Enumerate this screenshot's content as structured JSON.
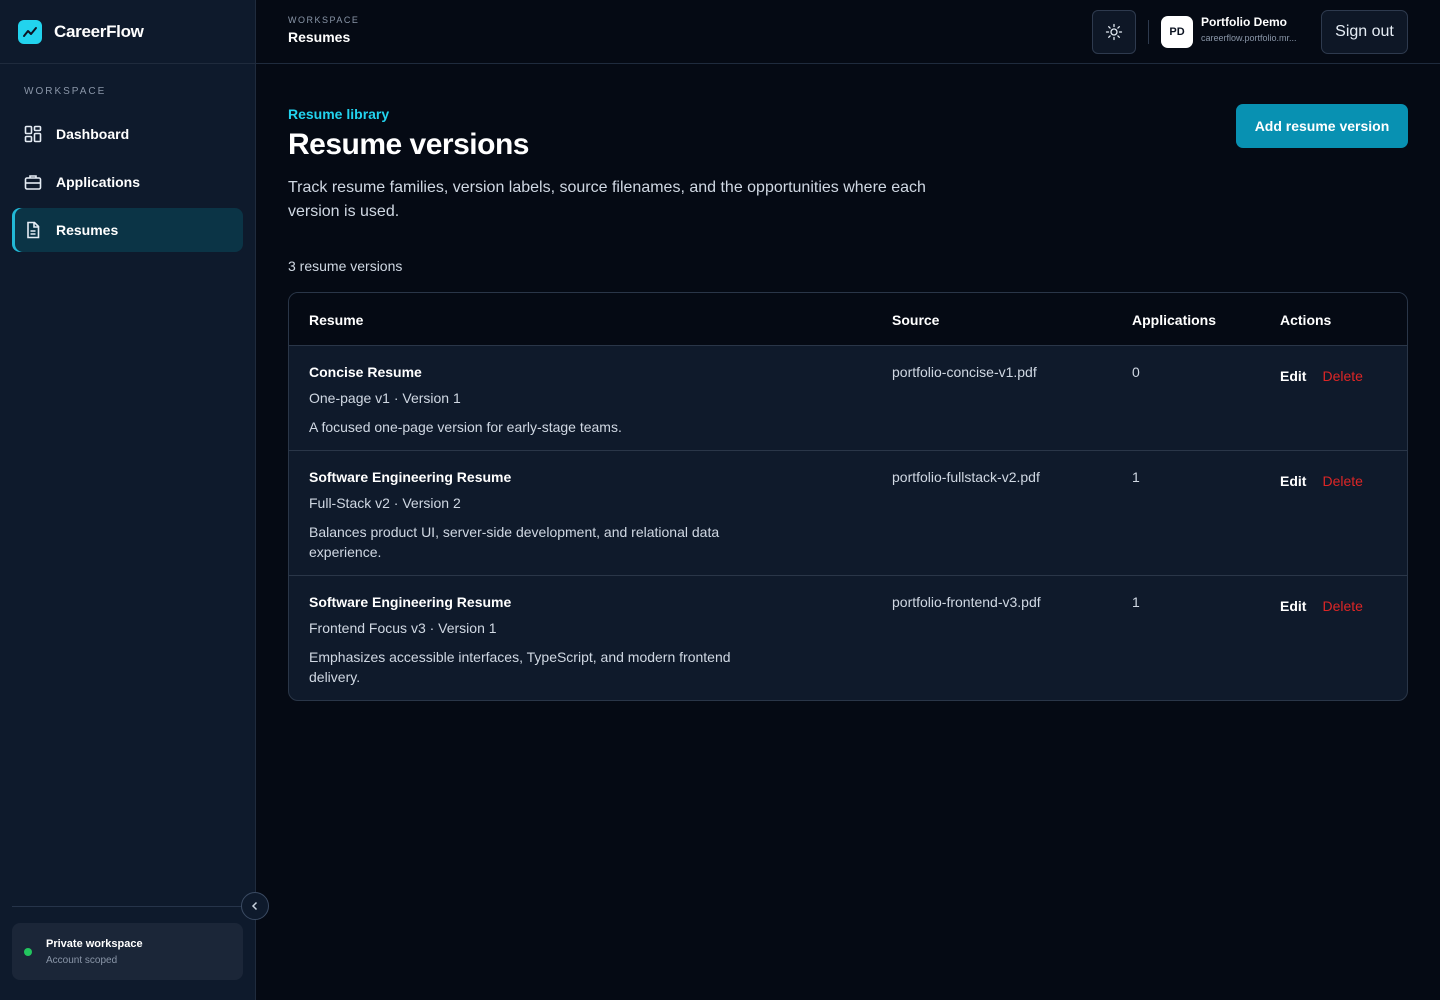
{
  "app": {
    "name": "CareerFlow"
  },
  "sidebar": {
    "section_label": "Workspace",
    "items": [
      {
        "label": "Dashboard",
        "icon": "dashboard-icon"
      },
      {
        "label": "Applications",
        "icon": "briefcase-icon"
      },
      {
        "label": "Resumes",
        "icon": "document-icon",
        "active": true
      }
    ],
    "footer": {
      "title": "Private workspace",
      "subtitle": "Account scoped",
      "status_color": "#22c55e"
    }
  },
  "header": {
    "section_label": "Workspace",
    "title": "Resumes",
    "user": {
      "initials": "PD",
      "name": "Portfolio Demo",
      "email": "careerflow.portfolio.mr..."
    },
    "sign_out_label": "Sign out"
  },
  "main": {
    "eyebrow": "Resume library",
    "title": "Resume versions",
    "description": "Track resume families, version labels, source filenames, and the opportunities where each version is used.",
    "add_button_label": "Add resume version",
    "count_label": "3 resume versions",
    "accent_color": "#22d3ee",
    "table": {
      "columns": [
        "Resume",
        "Source",
        "Applications",
        "Actions"
      ],
      "rows": [
        {
          "name": "Concise Resume",
          "meta": "One-page v1 · Version 1",
          "description": "A focused one-page version for early-stage teams.",
          "source": "portfolio-concise-v1.pdf",
          "applications": "0",
          "edit_label": "Edit",
          "delete_label": "Delete"
        },
        {
          "name": "Software Engineering Resume",
          "meta": "Full-Stack v2 · Version 2",
          "description": "Balances product UI, server-side development, and relational data experience.",
          "source": "portfolio-fullstack-v2.pdf",
          "applications": "1",
          "edit_label": "Edit",
          "delete_label": "Delete"
        },
        {
          "name": "Software Engineering Resume",
          "meta": "Frontend Focus v3 · Version 1",
          "description": "Emphasizes accessible interfaces, TypeScript, and modern frontend delivery.",
          "source": "portfolio-frontend-v3.pdf",
          "applications": "1",
          "edit_label": "Edit",
          "delete_label": "Delete"
        }
      ]
    }
  }
}
